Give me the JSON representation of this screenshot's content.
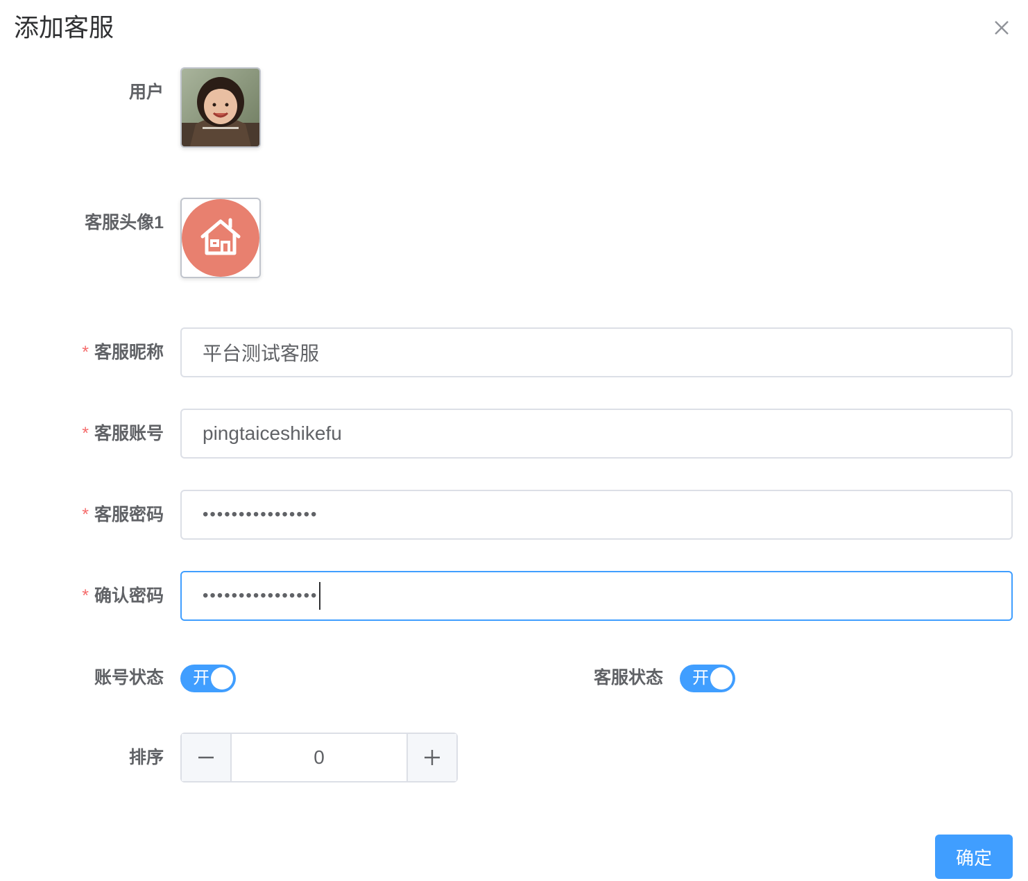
{
  "dialog": {
    "title": "添加客服"
  },
  "form": {
    "user": {
      "label": "用户"
    },
    "avatar": {
      "label": "客服头像1"
    },
    "nickname": {
      "label": "客服昵称",
      "value": "平台测试客服"
    },
    "account": {
      "label": "客服账号",
      "value": "pingtaiceshikefu"
    },
    "password": {
      "label": "客服密码",
      "value": "••••••••••••••••"
    },
    "confirm_password": {
      "label": "确认密码",
      "value": "••••••••••••••••"
    },
    "account_status": {
      "label": "账号状态",
      "switch_text": "开",
      "on": true
    },
    "service_status": {
      "label": "客服状态",
      "switch_text": "开",
      "on": true
    },
    "sort": {
      "label": "排序",
      "value": "0"
    }
  },
  "footer": {
    "confirm_label": "确定"
  },
  "colors": {
    "primary": "#409eff",
    "required": "#f56c6c",
    "avatar_bg": "#e8806f"
  },
  "icons": [
    "close-icon",
    "house-icon",
    "minus-icon",
    "plus-icon"
  ]
}
